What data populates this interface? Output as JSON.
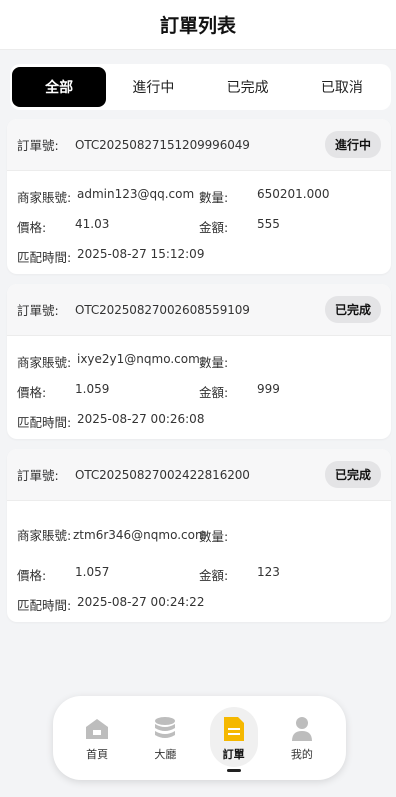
{
  "header": {
    "title": "訂單列表"
  },
  "tabs": [
    {
      "label": "全部",
      "active": true
    },
    {
      "label": "進行中",
      "active": false
    },
    {
      "label": "已完成",
      "active": false
    },
    {
      "label": "已取消",
      "active": false
    }
  ],
  "labels": {
    "order_no": "訂單號:",
    "merchant_account": "商家賬號:",
    "quantity": "數量:",
    "price": "價格:",
    "amount": "金額:",
    "match_time": "匹配時間:"
  },
  "orders": [
    {
      "order_no": "OTC20250827151209996049",
      "status": "進行中",
      "merchant_account": "admin123@qq.com",
      "quantity": "650201.000",
      "price": "41.03",
      "amount": "555",
      "match_time": "2025-08-27 15:12:09"
    },
    {
      "order_no": "OTC20250827002608559109",
      "status": "已完成",
      "merchant_account": "ixye2y1@nqmo.com",
      "quantity": "",
      "price": "1.059",
      "amount": "999",
      "match_time": "2025-08-27 00:26:08"
    },
    {
      "order_no": "OTC20250827002422816200",
      "status": "已完成",
      "merchant_account": "ztm6r346@nqmo.com",
      "quantity": "",
      "price": "1.057",
      "amount": "123",
      "match_time": "2025-08-27 00:24:22"
    }
  ],
  "nav": [
    {
      "label": "首頁",
      "icon": "home-icon"
    },
    {
      "label": "大廳",
      "icon": "database-icon"
    },
    {
      "label": "訂單",
      "icon": "document-icon",
      "active": true
    },
    {
      "label": "我的",
      "icon": "user-icon"
    }
  ],
  "colors": {
    "active_tab": "#000000",
    "active_nav_icon": "#f5b800",
    "badge_bg": "#e4e4e6"
  }
}
